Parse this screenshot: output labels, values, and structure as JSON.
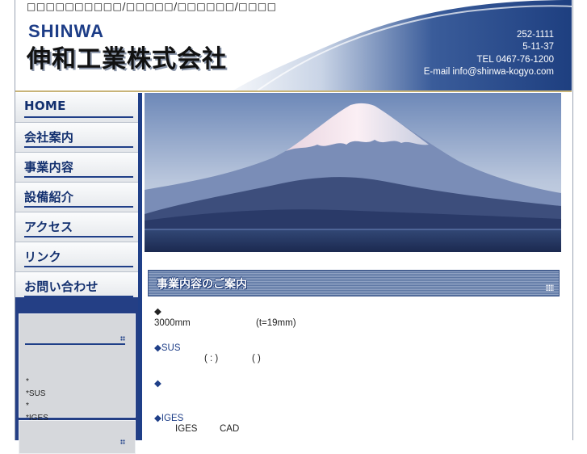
{
  "header": {
    "tagline": "□□□□□□□□□□/□□□□□/□□□□□□/□□□□",
    "logo_en": "SHINWA",
    "logo_jp": "伸和工業株式会社",
    "contact": [
      "252-1111",
      "5-11-37",
      "TEL 0467-76-1200",
      "E-mail info@shinwa-kogyo.com"
    ]
  },
  "nav": [
    {
      "label": "HOME"
    },
    {
      "label": "会社案内"
    },
    {
      "label": "事業内容"
    },
    {
      "label": "設備紹介"
    },
    {
      "label": "アクセス"
    },
    {
      "label": "リンク"
    },
    {
      "label": "お問い合わせ"
    }
  ],
  "side_box": {
    "items": [
      "*",
      "*SUS",
      "*",
      "*IGES"
    ]
  },
  "section": {
    "title": "事業内容のご案内"
  },
  "content": {
    "b1_head": "◆",
    "b1_a": "3000mm",
    "b1_b": "(t=19mm)",
    "b2_head": "◆SUS",
    "b2_a": "(  :  )",
    "b2_b": "(   )",
    "b3_head": "◆",
    "b4_head": "◆IGES",
    "b4_a": "IGES",
    "b4_b": "CAD"
  },
  "colors": {
    "navy": "#1f3f88",
    "accent_gold": "#c8b478"
  }
}
